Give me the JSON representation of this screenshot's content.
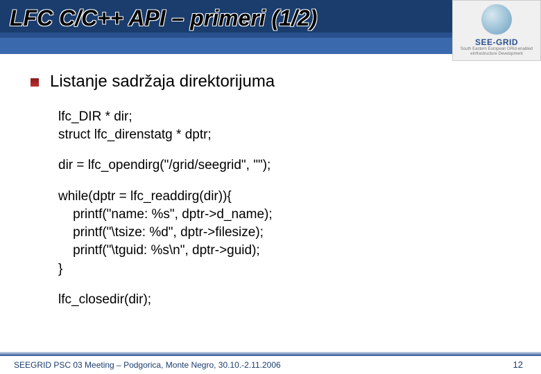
{
  "slide": {
    "title": "LFC C/C++ API – primeri (1/2)",
    "bullet": "Listanje sadržaja direktorijuma",
    "code": {
      "p1_l1": "lfc_DIR * dir;",
      "p1_l2": "struct lfc_direnstatg * dptr;",
      "p2_l1": "dir = lfc_opendirg(\"/grid/seegrid\", \"\");",
      "p3_l1": "while(dptr = lfc_readdirg(dir)){",
      "p3_l2": "    printf(\"name: %s\", dptr->d_name);",
      "p3_l3": "    printf(\"\\tsize: %d\", dptr->filesize);",
      "p3_l4": "    printf(\"\\tguid: %s\\n\", dptr->guid);",
      "p3_l5": "}",
      "p4_l1": "lfc_closedir(dir);"
    }
  },
  "logo": {
    "label": "SEE-GRID",
    "sub": "South Eastern European GRid-enabled eInfrastructure Development"
  },
  "footer": {
    "text": "SEEGRID PSC 03 Meeting – Podgorica, Monte Negro, 30.10.-2.11.2006",
    "page": "12"
  }
}
